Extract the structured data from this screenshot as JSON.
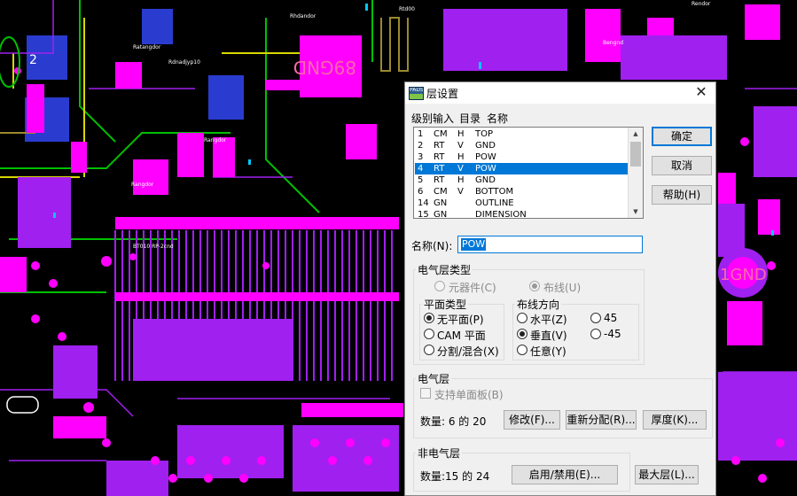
{
  "background": {
    "labels": [
      "89GND",
      "1GND",
      "2"
    ],
    "colors": {
      "magenta": "#ff00ff",
      "purple": "#a020f0",
      "green": "#00c000",
      "yellow": "#d8d800",
      "cyan": "#00c8ff",
      "olive": "#9a8a30"
    }
  },
  "dialog": {
    "icon": "pads-app-icon",
    "title": "层设置",
    "close": "✕",
    "list_headers": {
      "level_input": "级别输入",
      "dir": "目录",
      "name": "名称"
    },
    "layers": [
      {
        "num": "1",
        "type": "CM",
        "dir": "H",
        "name": "TOP",
        "selected": false
      },
      {
        "num": "2",
        "type": "RT",
        "dir": "V",
        "name": "GND",
        "selected": false
      },
      {
        "num": "3",
        "type": "RT",
        "dir": "H",
        "name": "POW",
        "selected": false
      },
      {
        "num": "4",
        "type": "RT",
        "dir": "V",
        "name": "POW",
        "selected": true
      },
      {
        "num": "5",
        "type": "RT",
        "dir": "H",
        "name": "GND",
        "selected": false
      },
      {
        "num": "6",
        "type": "CM",
        "dir": "V",
        "name": "BOTTOM",
        "selected": false
      },
      {
        "num": "14",
        "type": "GN",
        "dir": "",
        "name": "OUTLINE",
        "selected": false
      },
      {
        "num": "15",
        "type": "GN",
        "dir": "",
        "name": "DIMENSION",
        "selected": false
      }
    ],
    "buttons": {
      "ok": "确定",
      "cancel": "取消",
      "help": "帮助(H)"
    },
    "name_label": "名称(N):",
    "name_value": "POW",
    "elec_type": {
      "title": "电气层类型",
      "component": "元器件(C)",
      "routing": "布线(U)",
      "selected": "routing"
    },
    "plane_type": {
      "title": "平面类型",
      "options": [
        "无平面(P)",
        "CAM 平面",
        "分割/混合(X)"
      ],
      "selected": 0
    },
    "route_dir": {
      "title": "布线方向",
      "options": [
        "水平(Z)",
        "垂直(V)",
        "任意(Y)",
        "45",
        "-45"
      ],
      "selected": 1
    },
    "elec_layers": {
      "title": "电气层",
      "single_board": "支持单面板(B)",
      "count": "数量: 6 的 20",
      "modify": "修改(F)...",
      "reassign": "重新分配(R)...",
      "thickness": "厚度(K)..."
    },
    "non_elec": {
      "title": "非电气层",
      "count": "数量:15 的 24",
      "enable": "启用/禁用(E)...",
      "max_layer": "最大层(L)..."
    }
  }
}
